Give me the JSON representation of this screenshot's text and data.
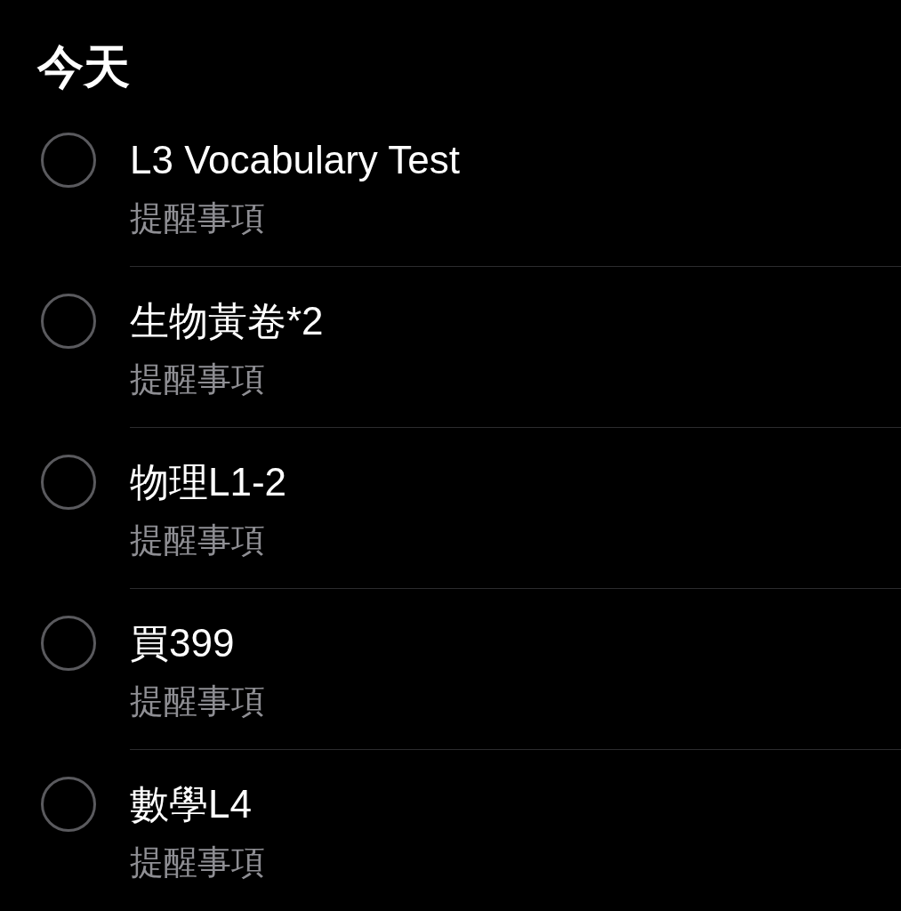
{
  "title": "今天",
  "reminders": [
    {
      "title": "L3 Vocabulary Test",
      "list": "提醒事項",
      "checked": false
    },
    {
      "title": "生物黃卷*2",
      "list": "提醒事項",
      "checked": false
    },
    {
      "title": "物理L1-2",
      "list": "提醒事項",
      "checked": false
    },
    {
      "title": "買399",
      "list": "提醒事項",
      "checked": false
    },
    {
      "title": "數學L4",
      "list": "提醒事項",
      "checked": false
    }
  ]
}
